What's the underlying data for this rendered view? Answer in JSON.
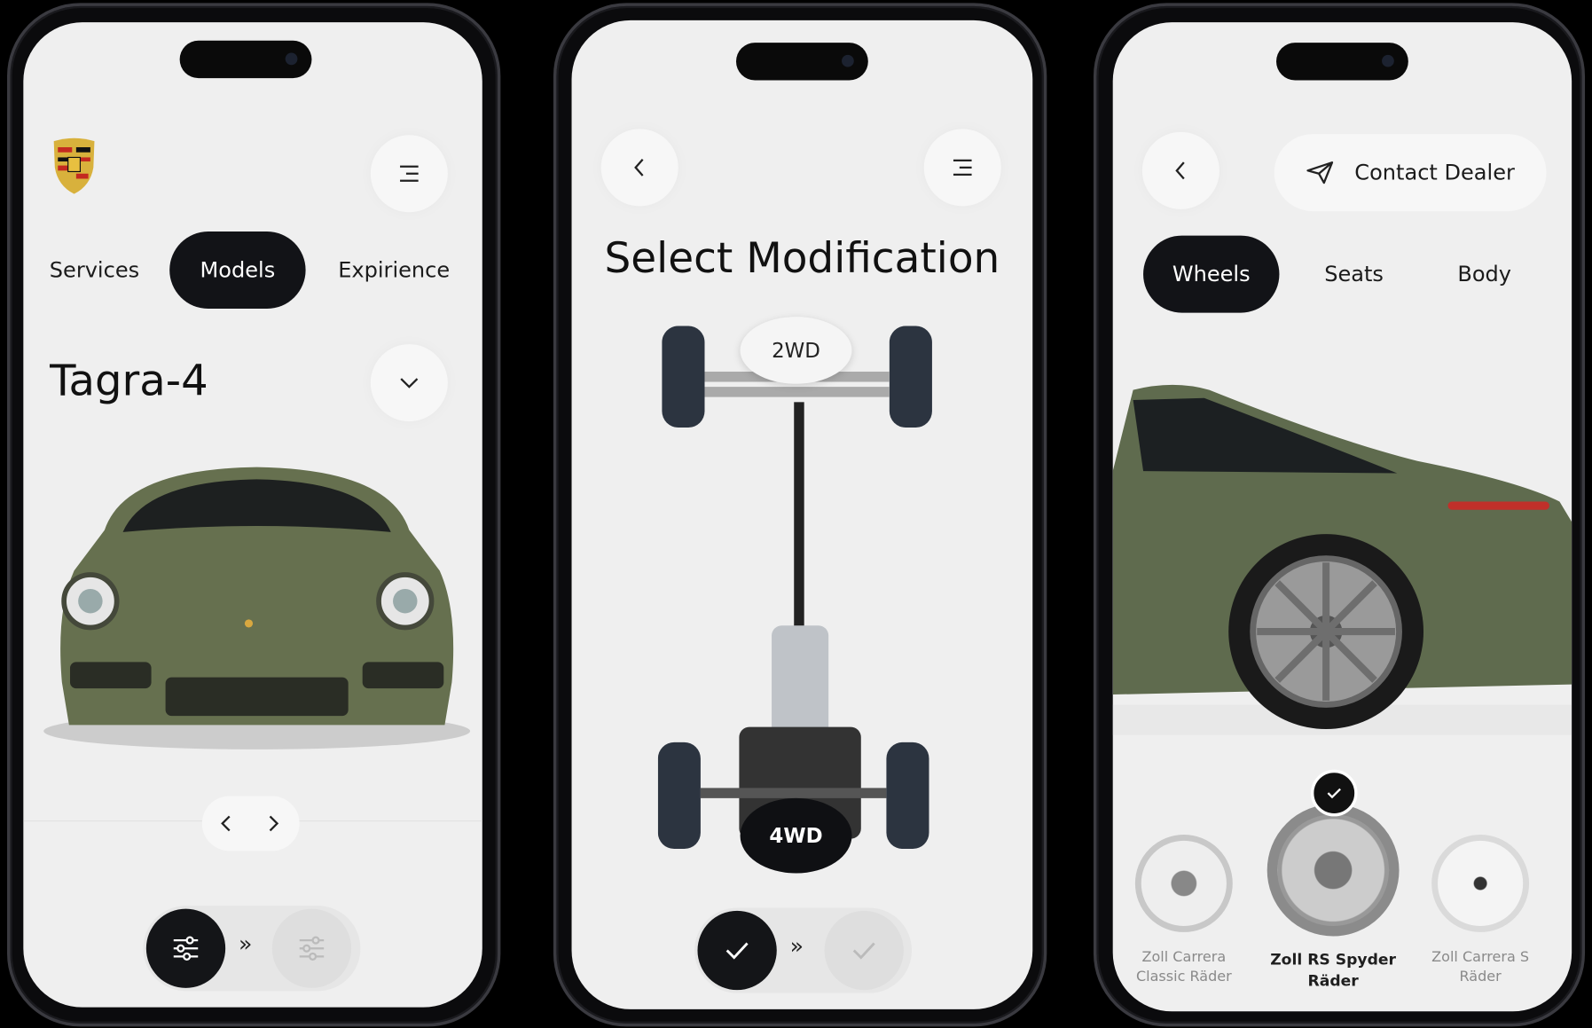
{
  "screen1": {
    "nav_tabs": [
      {
        "label": "Services"
      },
      {
        "label": "Models",
        "active": true
      },
      {
        "label": "Expirience"
      }
    ],
    "model_name": "Tagra-4",
    "icons": {
      "logo": "porsche-crest",
      "menu": "menu-icon",
      "dropdown": "chevron-down-icon",
      "prev": "chevron-left-icon",
      "next": "chevron-right-icon",
      "filter": "sliders-icon",
      "progress": "double-chevron-right-icon"
    },
    "progress_sep": "»"
  },
  "screen2": {
    "title": "Select Modification",
    "options": [
      {
        "label": "2WD",
        "selected": false
      },
      {
        "label": "4WD",
        "selected": true
      }
    ],
    "progress_sep": "»"
  },
  "screen3": {
    "contact_label": "Contact Dealer",
    "tabs": [
      {
        "label": "Wheels",
        "active": true
      },
      {
        "label": "Seats"
      },
      {
        "label": "Body"
      }
    ],
    "wheels": [
      {
        "line1": "Zoll Carrera",
        "line2": "Classic Räder",
        "selected": false
      },
      {
        "line1": "Zoll RS Spyder",
        "line2": "Räder",
        "selected": true
      },
      {
        "line1": "Zoll Carrera S",
        "line2": "Räder",
        "selected": false
      }
    ]
  },
  "colors": {
    "accent": "#121317",
    "screen_bg": "#efefef",
    "car_paint": "#5f6b4e"
  }
}
